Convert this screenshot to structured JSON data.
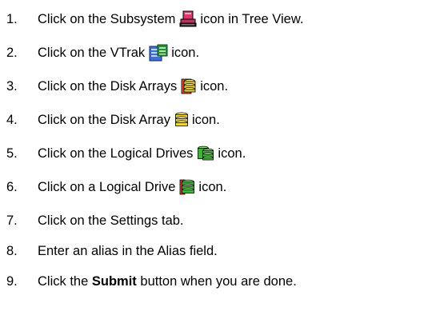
{
  "steps": [
    {
      "num": "1.",
      "before": "Click on the Subsystem",
      "after": "icon in Tree View.",
      "icon": "subsystem-icon"
    },
    {
      "num": "2.",
      "before": "Click on the VTrak",
      "after": "icon.",
      "icon": "vtrak-icon"
    },
    {
      "num": "3.",
      "before": "Click on the Disk Arrays",
      "after": "icon.",
      "icon": "disk-arrays-icon"
    },
    {
      "num": "4.",
      "before": "Click on the Disk Array",
      "after": "icon.",
      "icon": "disk-array-icon"
    },
    {
      "num": "5.",
      "before": "Click on the Logical Drives",
      "after": "icon.",
      "icon": "logical-drives-icon"
    },
    {
      "num": "6.",
      "before": "Click on a Logical Drive",
      "after": "icon.",
      "icon": "logical-drive-icon"
    },
    {
      "num": "7.",
      "text": "Click on the Settings tab."
    },
    {
      "num": "8.",
      "text": "Enter an alias in the Alias field."
    },
    {
      "num": "9.",
      "before": "Click the",
      "bold": "Submit",
      "after": "button when you are done."
    }
  ]
}
